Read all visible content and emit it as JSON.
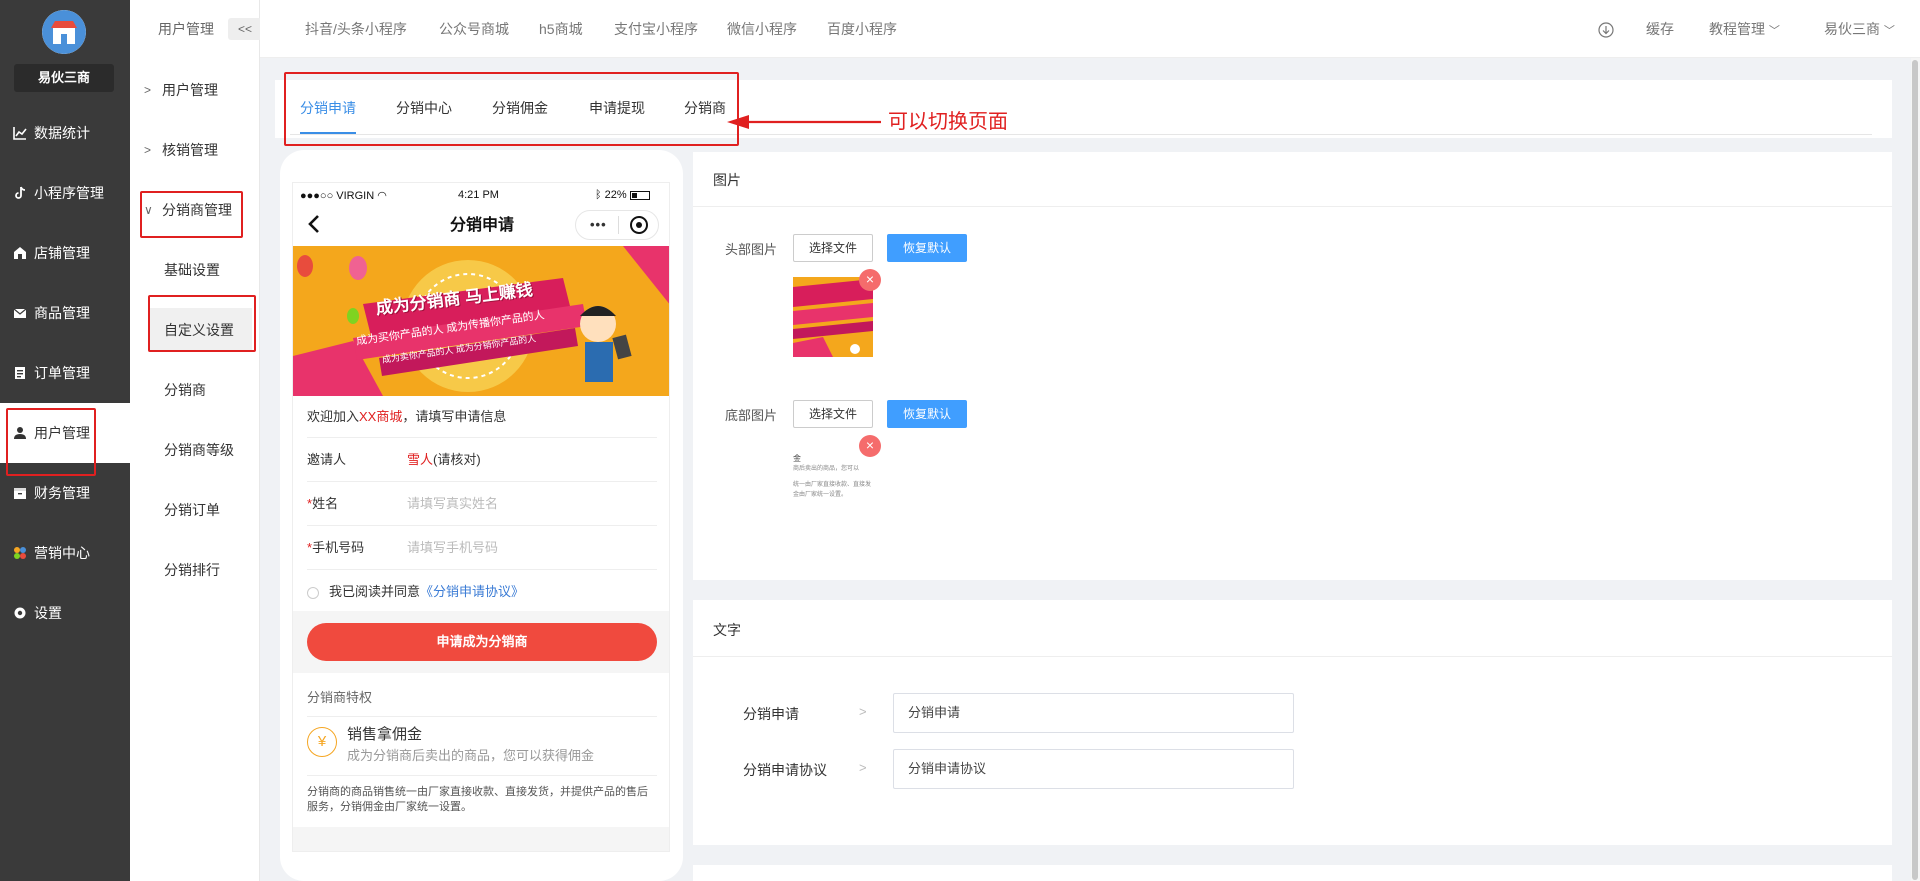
{
  "brand": {
    "name": "易伙三商"
  },
  "sidebar": {
    "items": [
      {
        "label": "数据统计",
        "icon": "chart-icon"
      },
      {
        "label": "小程序管理",
        "icon": "tiktok-icon"
      },
      {
        "label": "店铺管理",
        "icon": "store-icon"
      },
      {
        "label": "商品管理",
        "icon": "mail-icon"
      },
      {
        "label": "订单管理",
        "icon": "order-icon"
      },
      {
        "label": "用户管理",
        "icon": "user-icon"
      },
      {
        "label": "财务管理",
        "icon": "finance-icon"
      },
      {
        "label": "营销中心",
        "icon": "marketing-icon"
      },
      {
        "label": "设置",
        "icon": "gear-icon"
      }
    ],
    "active": "用户管理"
  },
  "subnav": {
    "title": "用户管理",
    "collapse_label": "<<",
    "groups": [
      "用户管理",
      "核销管理",
      "分销商管理"
    ],
    "items": [
      "基础设置",
      "自定义设置",
      "分销商",
      "分销商等级",
      "分销订单",
      "分销排行"
    ]
  },
  "topbar": {
    "links": [
      "抖音/头条小程序",
      "公众号商城",
      "h5商城",
      "支付宝小程序",
      "微信小程序",
      "百度小程序"
    ],
    "cache": "缓存",
    "tutorial": "教程管理",
    "user": "易伙三商"
  },
  "tabs": [
    "分销申请",
    "分销中心",
    "分销佣金",
    "申请提现",
    "分销商"
  ],
  "annotation": "可以切换页面",
  "phone": {
    "carrier": "●●●○○ VIRGIN",
    "time": "4:21 PM",
    "battery": "22%",
    "title": "分销申请",
    "banner_title": "成为分销商 马上赚钱",
    "banner_line1": "成为买你产品的人 成为传播你产品的人",
    "banner_line2": "成为卖你产品的人 成为分销你产品的人",
    "welcome_prefix": "欢迎加入",
    "welcome_shop": "XX商城",
    "welcome_suffix": "，请填写申请信息",
    "inviter_label": "邀请人",
    "inviter_name": "雪人",
    "inviter_note": "(请核对)",
    "name_label": "姓名",
    "name_placeholder": "请填写真实姓名",
    "phone_label": "手机号码",
    "phone_placeholder": "请填写手机号码",
    "agree_prefix": "我已阅读并同意",
    "agree_link": "《分销申请协议》",
    "apply_button": "申请成为分销商",
    "privilege_title": "分销商特权",
    "privilege_icon": "¥",
    "privilege_name": "销售拿佣金",
    "privilege_desc": "成为分销商后卖出的商品，您可以获得佣金",
    "footer_note": "分销商的商品销售统一由厂家直接收款、直接发货，并提供产品的售后服务，分销佣金由厂家统一设置。"
  },
  "images_section": {
    "title": "图片",
    "header_label": "头部图片",
    "footer_label": "底部图片",
    "choose_file": "选择文件",
    "reset_default": "恢复默认",
    "thumb2_lines": [
      "金",
      "商后卖出的商品，您可以",
      "统一由厂家直接收款、直接发",
      "金由厂家统一设置。"
    ]
  },
  "text_section": {
    "title": "文字",
    "rows": [
      {
        "label": "分销申请",
        "value": "分销申请"
      },
      {
        "label": "分销申请协议",
        "value": "分销申请协议"
      }
    ]
  }
}
